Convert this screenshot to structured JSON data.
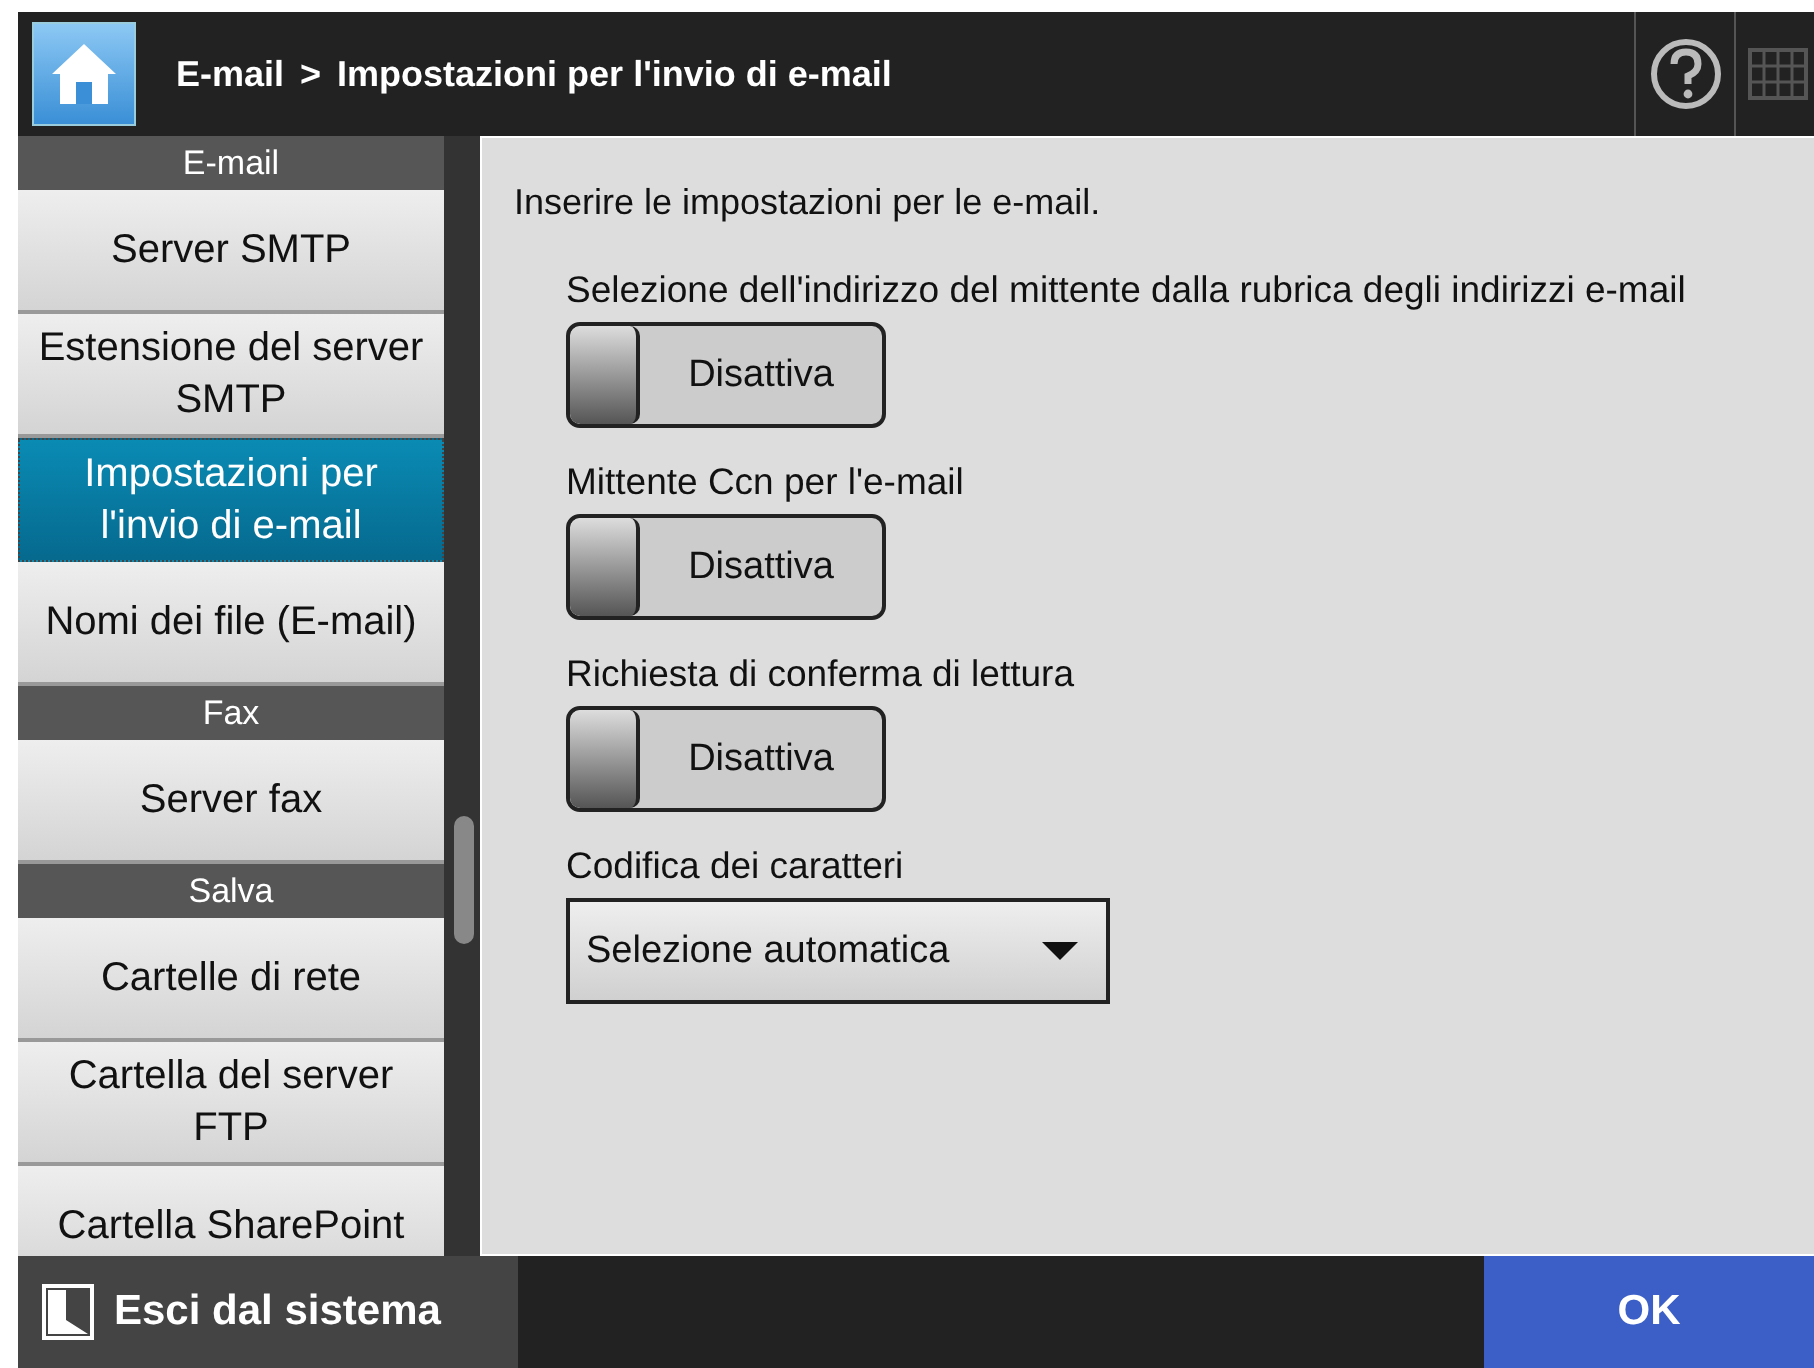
{
  "header": {
    "breadcrumb_parent": "E-mail",
    "separator": ">",
    "title": "Impostazioni per l'invio di e-mail"
  },
  "sidebar": {
    "groups": [
      {
        "label": "E-mail",
        "items": [
          {
            "label": "Server SMTP",
            "selected": false
          },
          {
            "label": "Estensione del server SMTP",
            "selected": false
          },
          {
            "label": "Impostazioni per l'invio di e-mail",
            "selected": true
          },
          {
            "label": "Nomi dei file (E-mail)",
            "selected": false
          }
        ]
      },
      {
        "label": "Fax",
        "items": [
          {
            "label": "Server fax",
            "selected": false
          }
        ]
      },
      {
        "label": "Salva",
        "items": [
          {
            "label": "Cartelle di rete",
            "selected": false
          },
          {
            "label": "Cartella del server FTP",
            "selected": false
          },
          {
            "label": "Cartella SharePoint",
            "selected": false
          }
        ]
      }
    ]
  },
  "content": {
    "intro": "Inserire le impostazioni per le e-mail.",
    "settings": [
      {
        "kind": "toggle",
        "label": "Selezione dell'indirizzo del mittente dalla rubrica degli indirizzi e-mail",
        "value": "Disattiva",
        "on": false
      },
      {
        "kind": "toggle",
        "label": "Mittente Ccn per l'e-mail",
        "value": "Disattiva",
        "on": false
      },
      {
        "kind": "toggle",
        "label": "Richiesta di conferma di lettura",
        "value": "Disattiva",
        "on": false
      },
      {
        "kind": "dropdown",
        "label": "Codifica dei caratteri",
        "value": "Selezione automatica"
      }
    ]
  },
  "footer": {
    "logout": "Esci dal sistema",
    "ok": "OK"
  }
}
